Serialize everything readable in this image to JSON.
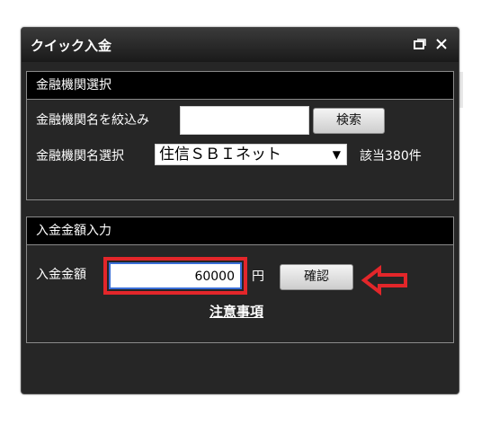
{
  "window": {
    "title": "クイック入金"
  },
  "bank_section": {
    "header": "金融機関選択",
    "narrow_label": "金融機関名を絞込み",
    "narrow_value": "",
    "search_button": "検索",
    "select_label": "金融機関名選択",
    "selected_bank": "住信ＳＢＩネット",
    "match_count": "該当380件"
  },
  "deposit_section": {
    "header": "入金金額入力",
    "amount_label": "入金金額",
    "amount_value": "60000",
    "unit": "円",
    "confirm_button": "確認",
    "notes_link": "注意事項"
  },
  "colors": {
    "highlight": "#e3262a",
    "window_bg": "#262626"
  },
  "icons": {
    "restore": "restore-window-icon",
    "close": "close-icon",
    "annotation": "left-arrow-icon"
  }
}
